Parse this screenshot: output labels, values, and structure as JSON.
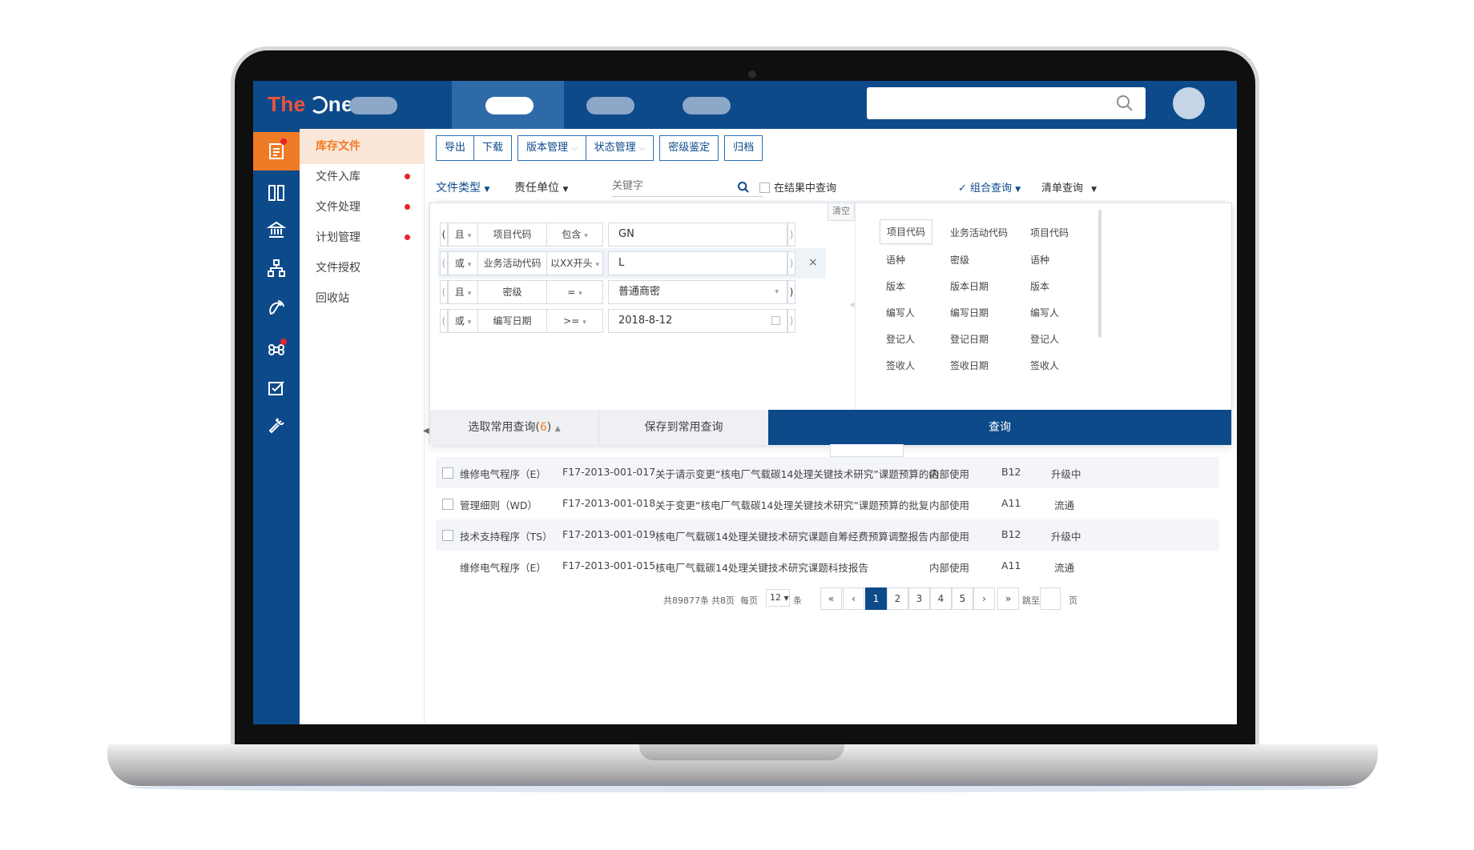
{
  "app": {
    "logo_prefix": "The",
    "logo_suffix": "ne"
  },
  "colors": {
    "primary": "#0d4a8a",
    "accent": "#f07b26",
    "alert": "#e8232b"
  },
  "sidebar_icons": [
    "document-icon",
    "columns-icon",
    "bank-icon",
    "org-chart-icon",
    "satellite-icon",
    "command-icon",
    "edit-check-icon",
    "wrench-icon"
  ],
  "submenu": {
    "items": [
      {
        "label": "库存文件"
      },
      {
        "label": "文件入库"
      },
      {
        "label": "文件处理"
      },
      {
        "label": "计划管理"
      },
      {
        "label": "文件授权"
      },
      {
        "label": "回收站"
      }
    ]
  },
  "toolbar": {
    "export": "导出",
    "download": "下载",
    "version": "版本管理",
    "status": "状态管理",
    "secret": "密级鉴定",
    "archive": "归档"
  },
  "filters": {
    "doc_type": "文件类型",
    "unit": "责任单位",
    "keyword_placeholder": "关键字",
    "in_results": "在结果中查询",
    "combo": "组合查询",
    "list": "清单查询"
  },
  "query": {
    "clear": "清空",
    "conditions": [
      {
        "left_paren": "(",
        "logic": "且",
        "field": "项目代码",
        "op": "包含",
        "value": "GN",
        "right_paren": ")"
      },
      {
        "left_paren": "(",
        "logic": "或",
        "field": "业务活动代码",
        "op": "以XX开头",
        "value": "L",
        "right_paren": ")"
      },
      {
        "left_paren": "(",
        "logic": "且",
        "field": "密级",
        "op": "=",
        "value": "普通商密",
        "right_paren": ")"
      },
      {
        "left_paren": "(",
        "logic": "或",
        "field": "编写日期",
        "op": ">=",
        "value": "2018-8-12",
        "right_paren": ")"
      }
    ],
    "close": "×",
    "fields": [
      [
        "项目代码",
        "业务活动代码",
        "项目代码"
      ],
      [
        "语种",
        "密级",
        "语种"
      ],
      [
        "版本",
        "版本日期",
        "版本"
      ],
      [
        "编写人",
        "编写日期",
        "编写人"
      ],
      [
        "登记人",
        "登记日期",
        "登记人"
      ],
      [
        "签收人",
        "签收日期",
        "签收人"
      ]
    ],
    "select_common": "选取常用查询(",
    "common_count": "6",
    "select_common_end": ")",
    "save_common": "保存到常用查询",
    "submit": "查询"
  },
  "table": {
    "rows": [
      {
        "type": "维修电气程序（E）",
        "code": "F17-2013-001-017",
        "title": "关于请示变更“核电厂气载碳14处理关键技术研究”课题预算的函",
        "scope": "内部使用",
        "level": "B12",
        "state": "升级中"
      },
      {
        "type": "管理细则（WD）",
        "code": "F17-2013-001-018",
        "title": "关于变更“核电厂气载碳14处理关键技术研究”课题预算的批复",
        "scope": "内部使用",
        "level": "A11",
        "state": "流通"
      },
      {
        "type": "技术支持程序（TS）",
        "code": "F17-2013-001-019",
        "title": "核电厂气载碳14处理关键技术研究课题自筹经费预算调整报告",
        "scope": "内部使用",
        "level": "B12",
        "state": "升级中"
      },
      {
        "type": "维修电气程序（E）",
        "code": "F17-2013-001-015",
        "title": "核电厂气载碳14处理关键技术研究课题科技报告",
        "scope": "内部使用",
        "level": "A11",
        "state": "流通"
      }
    ]
  },
  "pager": {
    "total": "共89877条",
    "pages": "共8页",
    "per_page": "每页",
    "size": "12",
    "unit": "条",
    "first": "«",
    "prev": "‹",
    "page_numbers": [
      "1",
      "2",
      "3",
      "4",
      "5"
    ],
    "next": "›",
    "last": "»",
    "jump": "跳至",
    "page_unit": "页"
  }
}
